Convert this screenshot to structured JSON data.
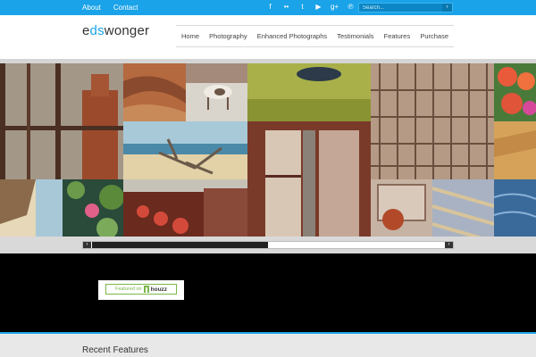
{
  "topbar": {
    "links": [
      "About",
      "Contact"
    ],
    "social_icons": [
      "facebook-icon",
      "flickr-icon",
      "twitter-icon",
      "youtube-icon",
      "google-plus-icon",
      "pinterest-icon"
    ],
    "search_placeholder": "Search...",
    "search_button": "›",
    "bg_color": "#1aa3e8"
  },
  "header": {
    "logo_prefix": "e",
    "logo_accent": "ds",
    "logo_suffix": "wonger",
    "nav": [
      "Home",
      "Photography",
      "Enhanced Photographs",
      "Testimonials",
      "Features",
      "Purchase"
    ]
  },
  "gallery": {
    "scroll_position": 0.46,
    "left_arrow": "‹",
    "right_arrow": "›"
  },
  "video": {
    "badge_featured": "Featured on",
    "badge_brand": "houzz"
  },
  "footer": {
    "section_title": "Recent Features"
  }
}
